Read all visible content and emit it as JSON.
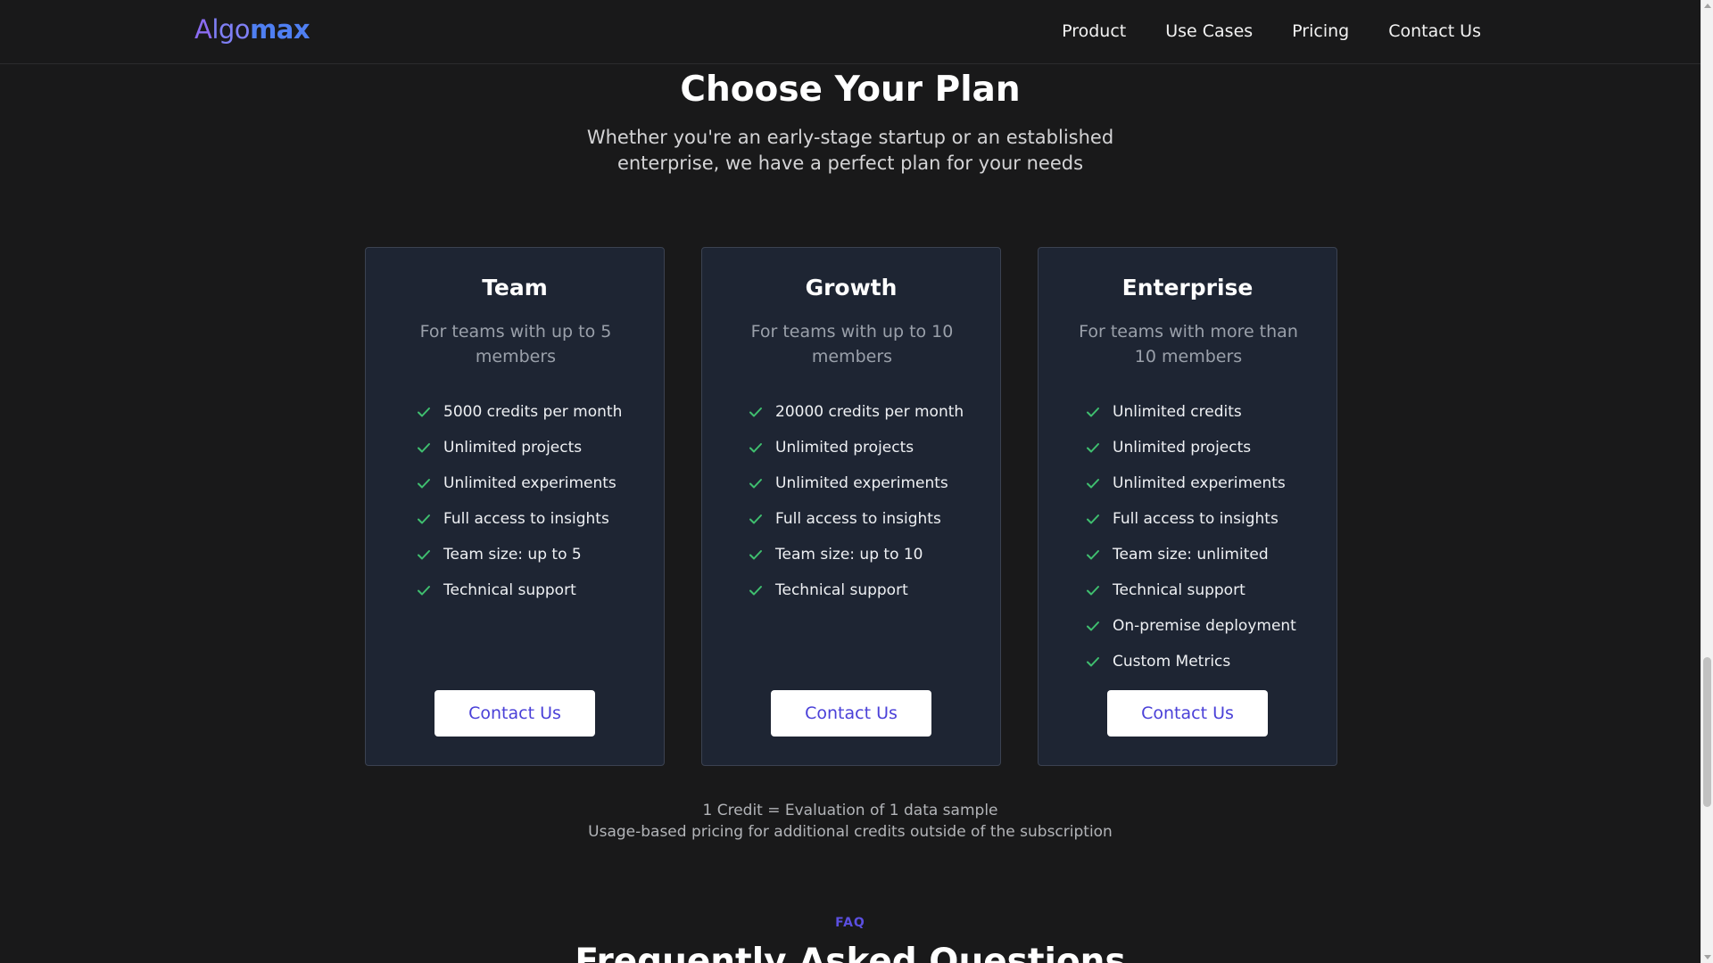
{
  "brand": {
    "logo_a": "A",
    "logo_go": "lgo",
    "logo_max": "max",
    "colors": {
      "primary": "#4f7ff2",
      "accent": "#8b6cf2",
      "button_text": "#4a40d8",
      "check": "#3fbf6f"
    }
  },
  "nav": {
    "items": [
      {
        "label": "Product"
      },
      {
        "label": "Use Cases"
      },
      {
        "label": "Pricing"
      },
      {
        "label": "Contact Us"
      }
    ]
  },
  "pricing": {
    "title": "Choose Your Plan",
    "subtitle": "Whether you're an early-stage startup or an established enterprise, we have a perfect plan for your needs",
    "plans": [
      {
        "name": "Team",
        "description": "For teams with up to 5 members",
        "features": [
          "5000 credits per month",
          "Unlimited projects",
          "Unlimited experiments",
          "Full access to insights",
          "Team size: up to 5",
          "Technical support"
        ],
        "cta": "Contact Us"
      },
      {
        "name": "Growth",
        "description": "For teams with up to 10 members",
        "features": [
          "20000 credits per month",
          "Unlimited projects",
          "Unlimited experiments",
          "Full access to insights",
          "Team size: up to 10",
          "Technical support"
        ],
        "cta": "Contact Us"
      },
      {
        "name": "Enterprise",
        "description": "For teams with more than 10 members",
        "features": [
          "Unlimited credits",
          "Unlimited projects",
          "Unlimited experiments",
          "Full access to insights",
          "Team size: unlimited",
          "Technical support",
          "On-premise deployment",
          "Custom Metrics"
        ],
        "cta": "Contact Us"
      }
    ],
    "notes": [
      "1 Credit = Evaluation of 1 data sample",
      "Usage-based pricing for additional credits outside of the subscription"
    ]
  },
  "faq": {
    "label": "FAQ",
    "title": "Frequently Asked Questions"
  }
}
